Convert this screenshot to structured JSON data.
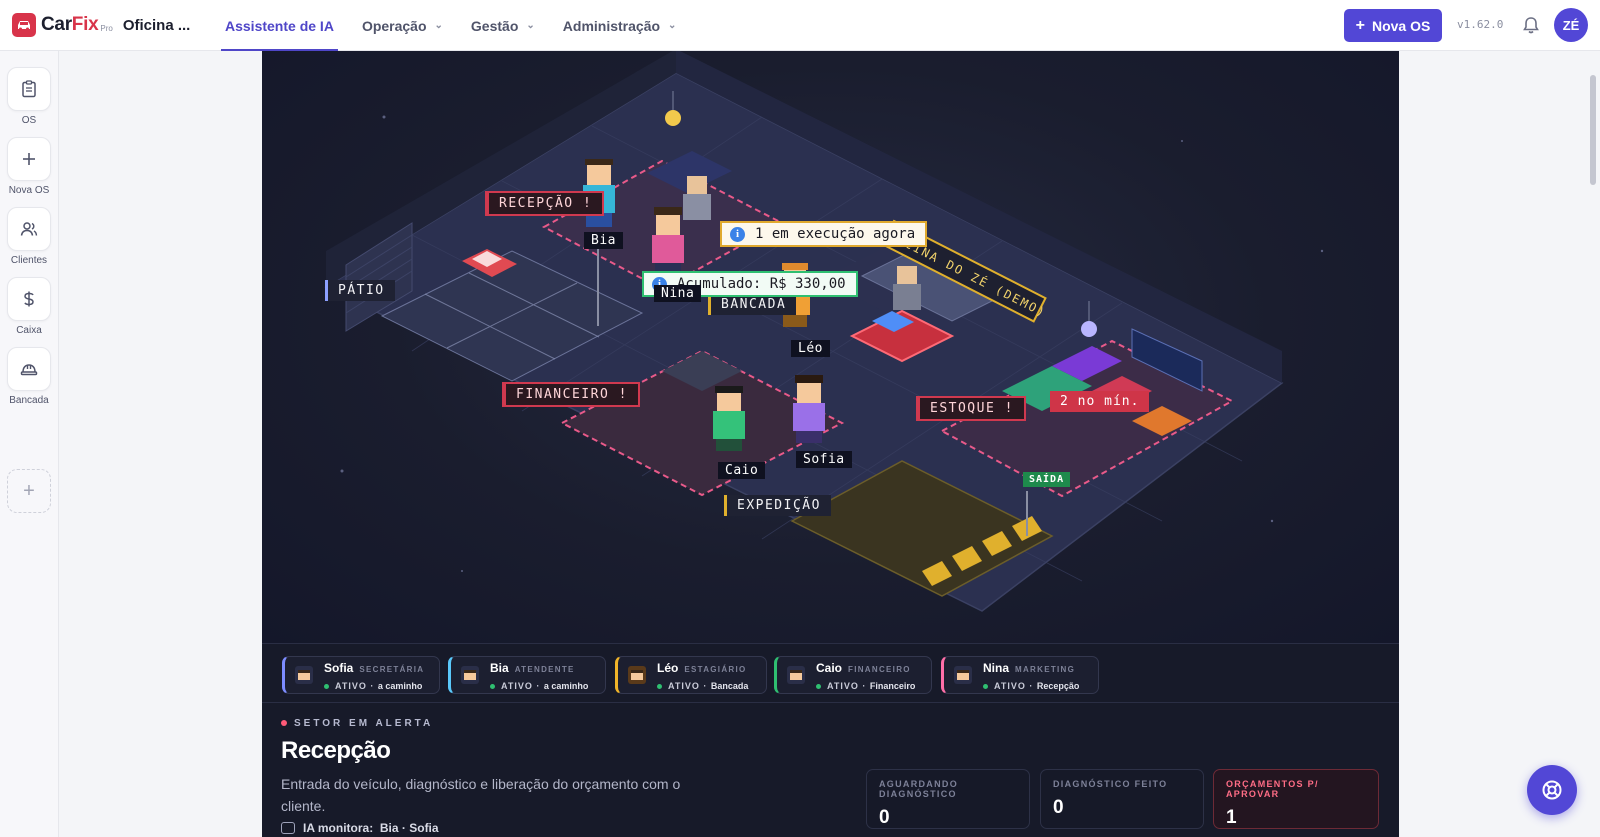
{
  "brand": {
    "name_a": "Car",
    "name_b": "Fix",
    "sub": "Pro",
    "shop": "Oficina ..."
  },
  "nav": [
    {
      "label": "Assistente de IA",
      "active": true,
      "dropdown": false
    },
    {
      "label": "Operação",
      "active": false,
      "dropdown": true
    },
    {
      "label": "Gestão",
      "active": false,
      "dropdown": true
    },
    {
      "label": "Administração",
      "active": false,
      "dropdown": true
    }
  ],
  "header": {
    "new_os_label": "Nova OS",
    "version": "v1.62.0",
    "avatar": "ZÉ"
  },
  "sidebar": {
    "items": [
      {
        "label": "OS",
        "icon": "clipboard-icon"
      },
      {
        "label": "Nova OS",
        "icon": "plus-icon"
      },
      {
        "label": "Clientes",
        "icon": "users-icon"
      },
      {
        "label": "Caixa",
        "icon": "dollar-icon"
      },
      {
        "label": "Bancada",
        "icon": "hardhat-icon"
      }
    ]
  },
  "scene": {
    "sign": "OFICINA DO ZÉ (DEMO)",
    "sectors": {
      "recepcao": "RECEPÇÃO !",
      "patio": "PÁTIO",
      "bancada": "BANCADA",
      "financeiro": "FINANCEIRO !",
      "estoque": "ESTOQUE !",
      "expedicao": "EXPEDIÇÃO",
      "saida": "SAÍDA"
    },
    "bubbles": {
      "execucao": "1 em execução agora",
      "acumulado": "Acumulado: R$ 330,00",
      "estoque_min": "2 no mín."
    },
    "names": {
      "bia": "Bia",
      "nina": "Nina",
      "leo": "Léo",
      "caio": "Caio",
      "sofia": "Sofia"
    }
  },
  "agents": [
    {
      "name": "Sofia",
      "role": "SECRETÁRIA",
      "status": "ATIVO",
      "location": "a caminho",
      "accent": "#7d8cff"
    },
    {
      "name": "Bia",
      "role": "ATENDENTE",
      "status": "ATIVO",
      "location": "a caminho",
      "accent": "#5ac8fa"
    },
    {
      "name": "Léo",
      "role": "ESTAGIÁRIO",
      "status": "ATIVO",
      "location": "Bancada",
      "accent": "#f0b429"
    },
    {
      "name": "Caio",
      "role": "FINANCEIRO",
      "status": "ATIVO",
      "location": "Financeiro",
      "accent": "#2fbf71"
    },
    {
      "name": "Nina",
      "role": "MARKETING",
      "status": "ATIVO",
      "location": "Recepção",
      "accent": "#ff6fa8"
    }
  ],
  "detail": {
    "alert_label": "SETOR EM ALERTA",
    "title": "Recepção",
    "description": "Entrada do veículo, diagnóstico e liberação do orçamento com o cliente.",
    "monitor_label": "IA monitora:",
    "monitor_agents": "Bia · Sofia",
    "metrics": [
      {
        "label": "AGUARDANDO DIAGNÓSTICO",
        "value": "0"
      },
      {
        "label": "DIAGNÓSTICO FEITO",
        "value": "0"
      },
      {
        "label": "ORÇAMENTOS P/ APROVAR",
        "value": "1"
      }
    ]
  }
}
